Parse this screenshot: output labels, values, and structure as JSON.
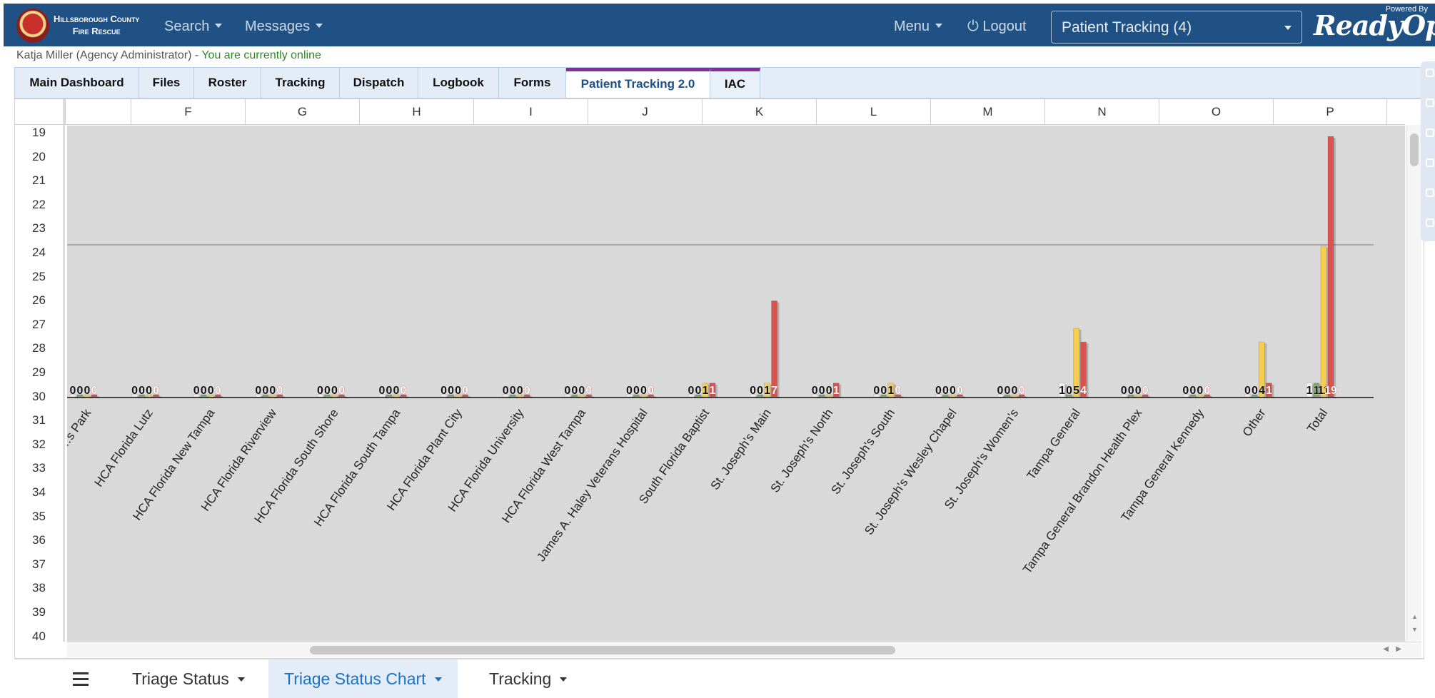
{
  "header": {
    "org_line1": "Hillsborough County",
    "org_line2": "Fire Rescue",
    "nav_search": "Search",
    "nav_messages": "Messages",
    "menu": "Menu",
    "logout": "Logout",
    "tracking_select": "Patient Tracking (4)",
    "powered_by": "Powered By",
    "brand": "ReadyOp"
  },
  "status": {
    "user": "Katja Miller (Agency Administrator) - ",
    "online": "You are currently online"
  },
  "tabs": [
    "Main Dashboard",
    "Files",
    "Roster",
    "Tracking",
    "Dispatch",
    "Logbook",
    "Forms",
    "Patient Tracking 2.0",
    "IAC"
  ],
  "columns": [
    "F",
    "G",
    "H",
    "I",
    "J",
    "K",
    "L",
    "M",
    "N",
    "O",
    "P"
  ],
  "rows": [
    "19",
    "20",
    "21",
    "22",
    "23",
    "24",
    "25",
    "26",
    "27",
    "28",
    "29",
    "30",
    "31",
    "32",
    "33",
    "34",
    "35",
    "36",
    "37",
    "38",
    "39",
    "40"
  ],
  "bottom_tabs": [
    "Triage Status",
    "Triage Status Chart",
    "Tracking"
  ],
  "chart_data": {
    "type": "bar",
    "categories": [
      "…s Park",
      "HCA Florida Lutz",
      "HCA Florida New Tampa",
      "HCA Florida Riverview",
      "HCA Florida South Shore",
      "HCA Florida South Tampa",
      "HCA Florida Plant City",
      "HCA Florida University",
      "HCA Florida West Tampa",
      "James A. Haley Veterans Hospital",
      "South Florida Baptist",
      "St. Joseph's Main",
      "St. Joseph's North",
      "St. Joseph's South",
      "St. Joseph's Wesley Chapel",
      "St. Joseph's Women's",
      "Tampa General",
      "Tampa General Brandon Health Plex",
      "Tampa General Kennedy",
      "Other",
      "Total"
    ],
    "series": [
      {
        "color": "#f2f2f2",
        "values": [
          0,
          0,
          0,
          0,
          0,
          0,
          0,
          0,
          0,
          0,
          0,
          0,
          0,
          0,
          0,
          0,
          1,
          0,
          0,
          0,
          1
        ]
      },
      {
        "color": "#7fa86a",
        "values": [
          0,
          0,
          0,
          0,
          0,
          0,
          0,
          0,
          0,
          0,
          0,
          0,
          0,
          0,
          0,
          0,
          0,
          0,
          0,
          0,
          1
        ]
      },
      {
        "color": "#f5cd4f",
        "values": [
          0,
          0,
          0,
          0,
          0,
          0,
          0,
          0,
          0,
          0,
          1,
          1,
          0,
          1,
          0,
          0,
          5,
          0,
          0,
          4,
          11
        ]
      },
      {
        "color": "#d9534f",
        "values": [
          0,
          0,
          0,
          0,
          0,
          0,
          0,
          0,
          0,
          0,
          1,
          7,
          1,
          0,
          0,
          0,
          4,
          0,
          0,
          1,
          19
        ]
      }
    ]
  }
}
